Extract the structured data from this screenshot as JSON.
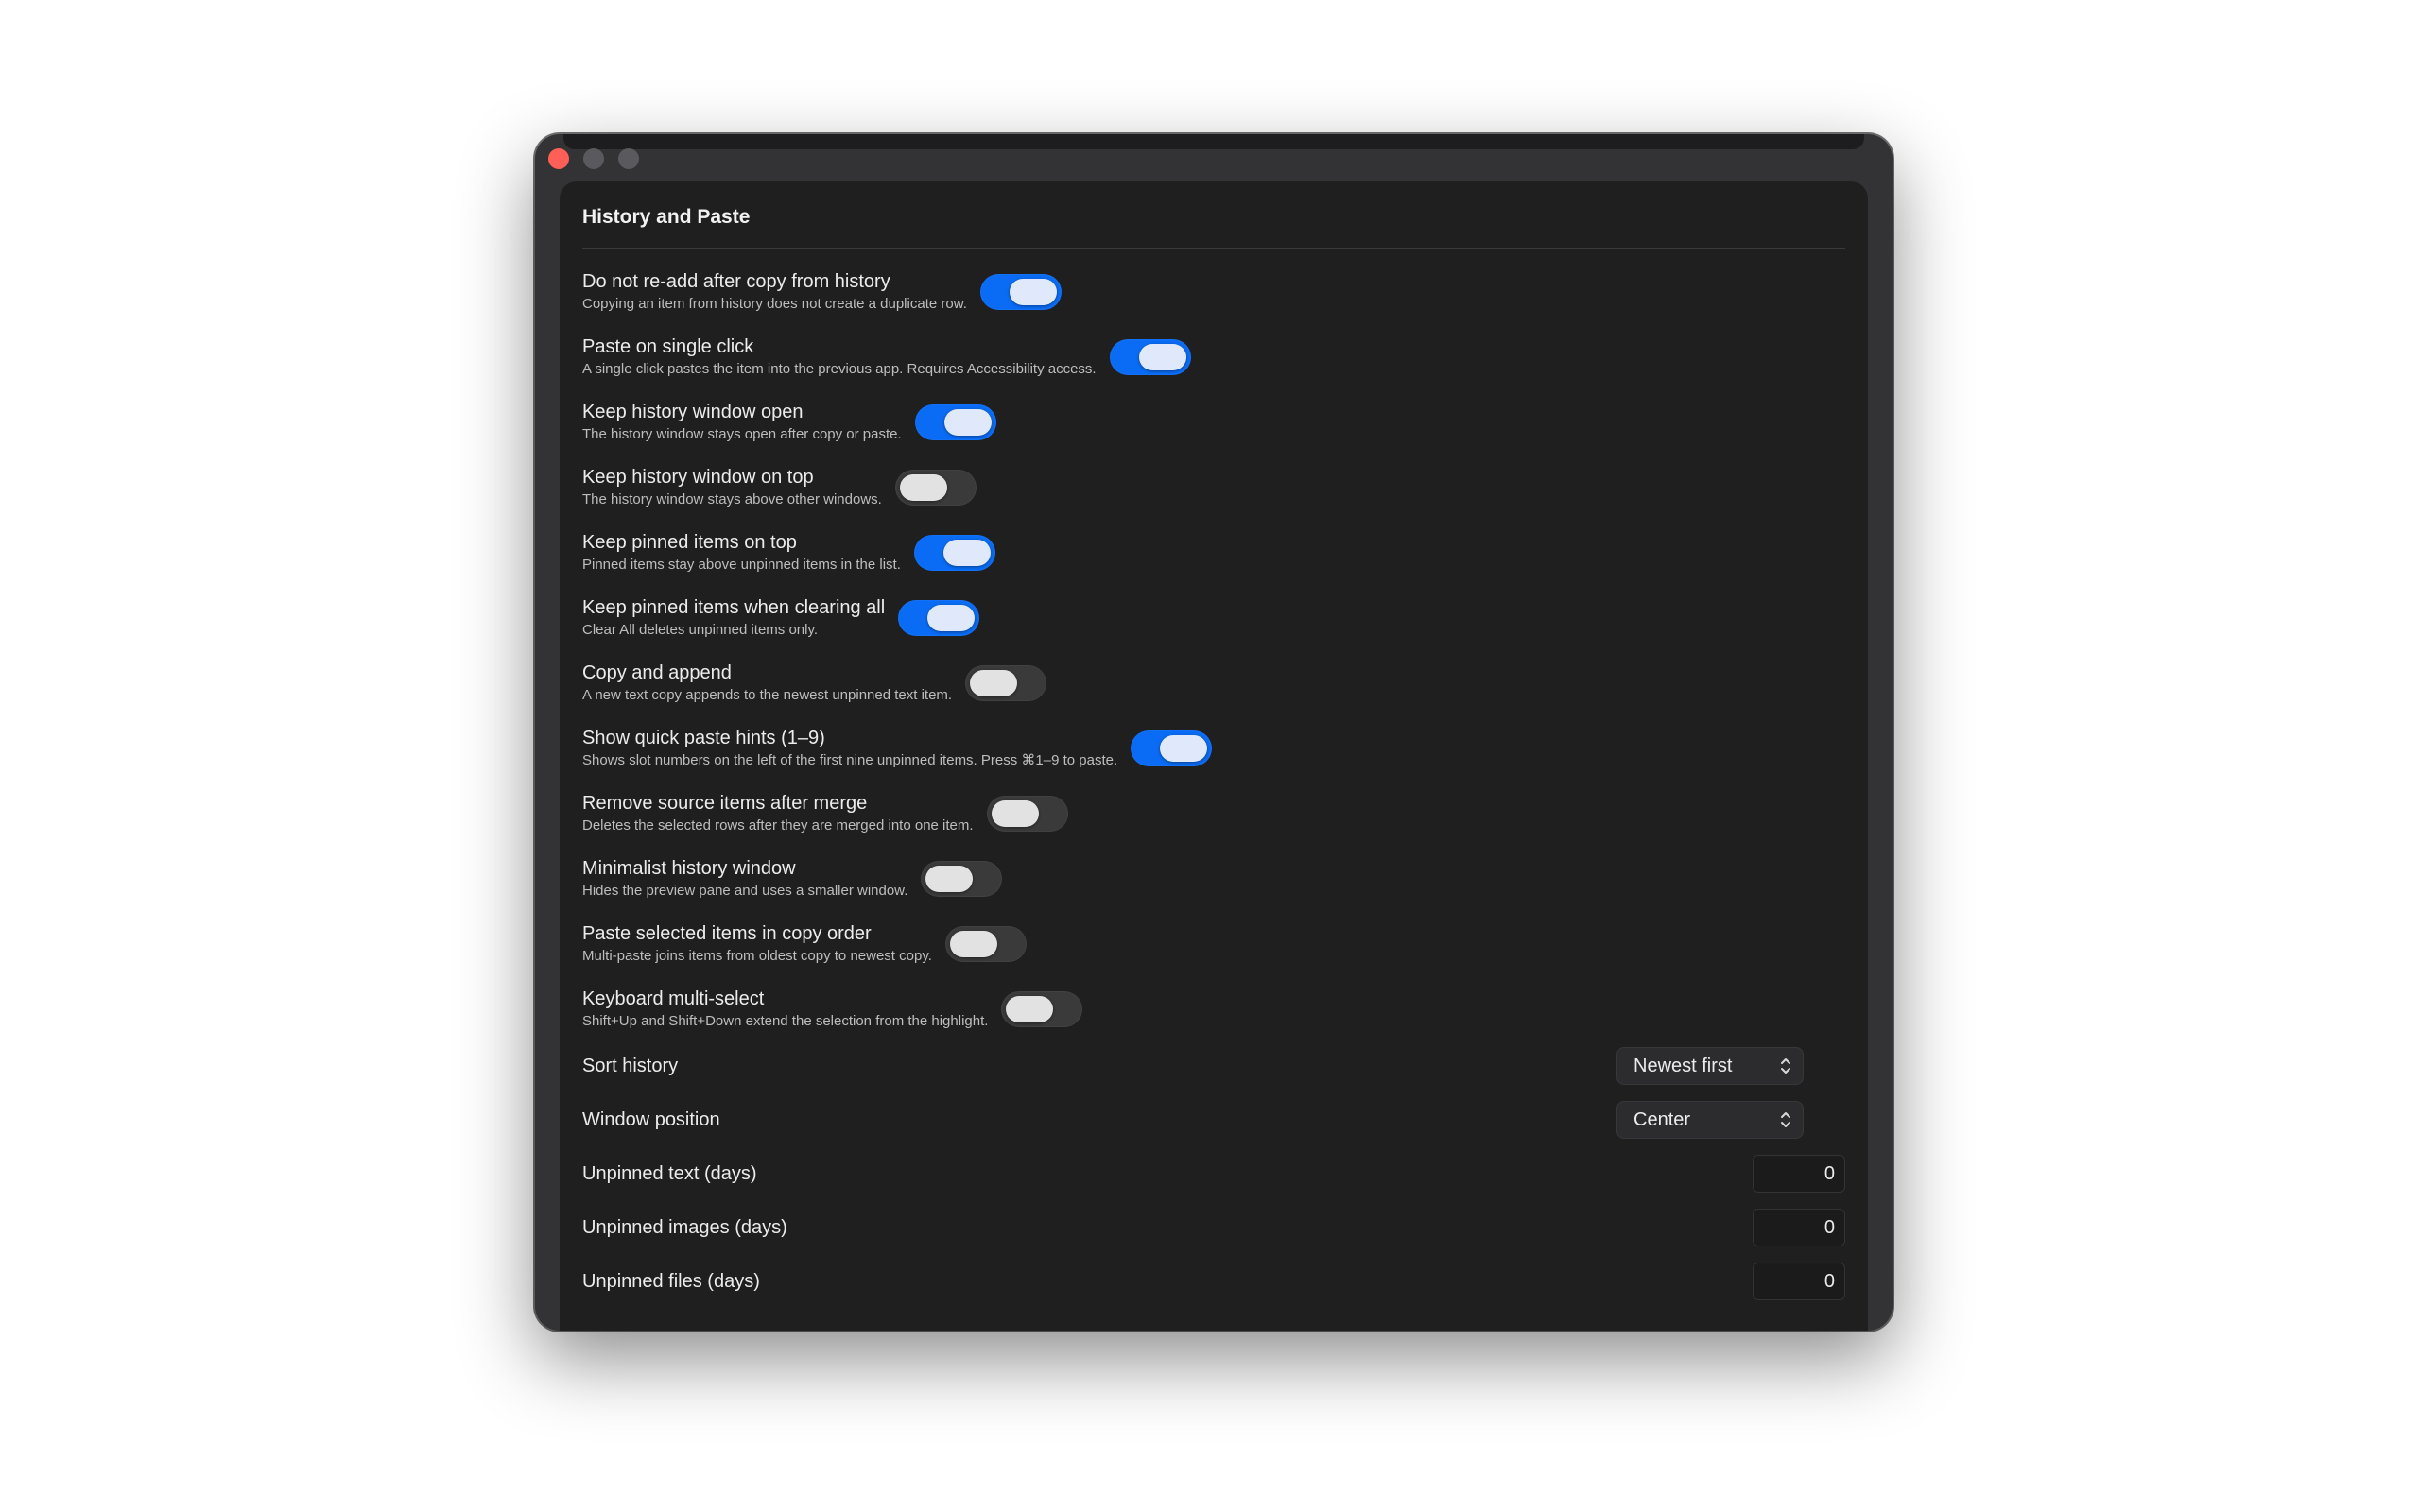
{
  "window": {
    "traffic_lights": [
      "close",
      "minimize",
      "maximize"
    ]
  },
  "section": {
    "title": "History and Paste"
  },
  "toggles": [
    {
      "label": "Do not re-add after copy from history",
      "description": "Copying an item from history does not create a duplicate row.",
      "on": true
    },
    {
      "label": "Paste on single click",
      "description": "A single click pastes the item into the previous app. Requires Accessibility access.",
      "on": true
    },
    {
      "label": "Keep history window open",
      "description": "The history window stays open after copy or paste.",
      "on": true
    },
    {
      "label": "Keep history window on top",
      "description": "The history window stays above other windows.",
      "on": false
    },
    {
      "label": "Keep pinned items on top",
      "description": "Pinned items stay above unpinned items in the list.",
      "on": true
    },
    {
      "label": "Keep pinned items when clearing all",
      "description": "Clear All deletes unpinned items only.",
      "on": true
    },
    {
      "label": "Copy and append",
      "description": "A new text copy appends to the newest unpinned text item.",
      "on": false
    },
    {
      "label": "Show quick paste hints (1–9)",
      "description": "Shows slot numbers on the left of the first nine unpinned items. Press ⌘1–9 to paste.",
      "on": true
    },
    {
      "label": "Remove source items after merge",
      "description": "Deletes the selected rows after they are merged into one item.",
      "on": false
    },
    {
      "label": "Minimalist history window",
      "description": "Hides the preview pane and uses a smaller window.",
      "on": false
    },
    {
      "label": "Paste selected items in copy order",
      "description": "Multi-paste joins items from oldest copy to newest copy.",
      "on": false
    },
    {
      "label": "Keyboard multi-select",
      "description": "Shift+Up and Shift+Down extend the selection from the highlight.",
      "on": false
    }
  ],
  "selects": [
    {
      "label": "Sort history",
      "value": "Newest first"
    },
    {
      "label": "Window position",
      "value": "Center"
    }
  ],
  "number_fields": [
    {
      "label": "Unpinned text (days)",
      "value": "0"
    },
    {
      "label": "Unpinned images (days)",
      "value": "0"
    },
    {
      "label": "Unpinned files (days)",
      "value": "0"
    }
  ],
  "colors": {
    "toggle_on": "#0a6cf5",
    "toggle_off": "#3a3a3a",
    "panel_bg": "#1f1f1f",
    "close_button": "#ff5f57"
  }
}
